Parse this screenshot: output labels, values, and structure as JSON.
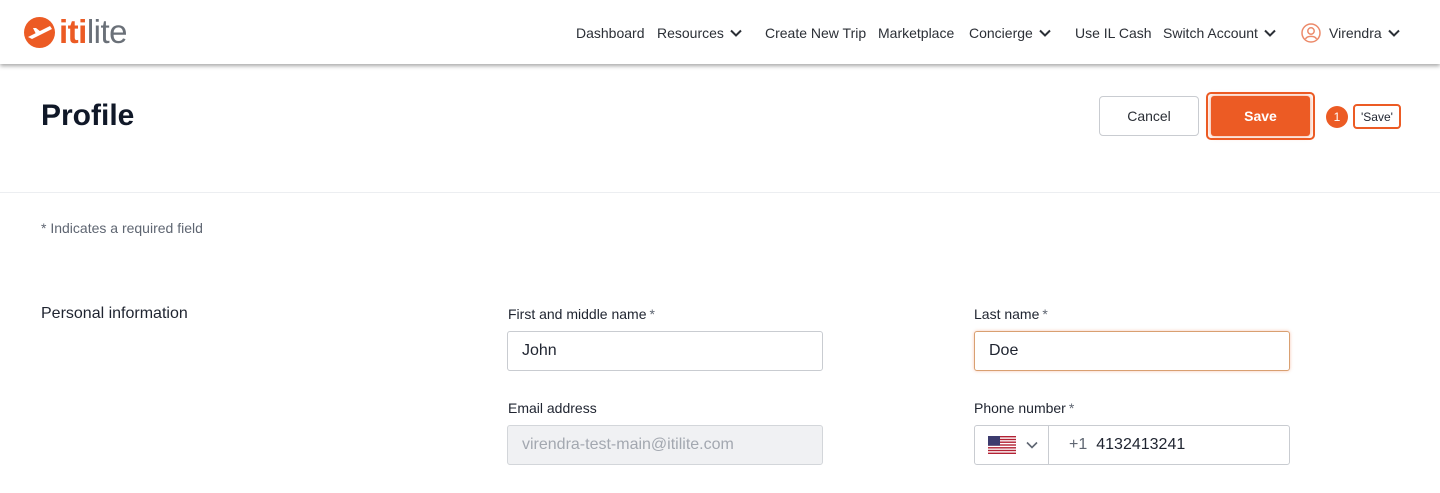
{
  "brand": {
    "name_part1": "iti",
    "name_part2": "lite",
    "accent": "#ec5b24",
    "logo_icon": "plane-logo-icon"
  },
  "nav": {
    "dashboard": "Dashboard",
    "resources": "Resources",
    "create_trip": "Create New Trip",
    "marketplace": "Marketplace",
    "concierge": "Concierge",
    "il_cash": "Use IL Cash",
    "switch_account": "Switch Account",
    "user_name": "Virendra"
  },
  "header": {
    "title": "Profile",
    "cancel_label": "Cancel",
    "save_label": "Save"
  },
  "annotation": {
    "index": "1",
    "label": "'Save'"
  },
  "form": {
    "required_note": "* Indicates a required field",
    "section_title": "Personal information",
    "first_name_label": "First and middle name",
    "first_name_value": "John",
    "last_name_label": "Last name",
    "last_name_value": "Doe",
    "email_label": "Email address",
    "email_value": "virendra-test-main@itilite.com",
    "phone_label": "Phone number",
    "phone_country_icon": "us-flag-icon",
    "phone_code": "+1",
    "phone_value": "4132413241",
    "required_mark": "*"
  }
}
